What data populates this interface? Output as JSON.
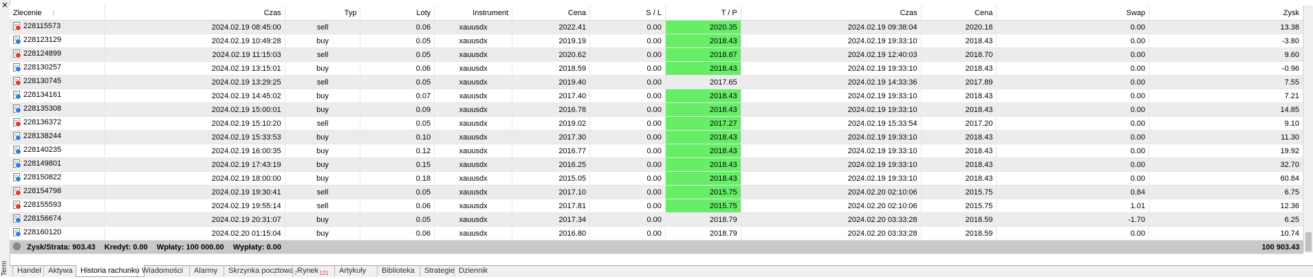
{
  "panel": {
    "close_glyph": "×",
    "side_label": "Terminal"
  },
  "columns": {
    "ticket": "Zlecenie",
    "sort_glyph": "/",
    "open_time": "Czas",
    "type": "Typ",
    "lots": "Loty",
    "symbol": "Instrument",
    "open_price": "Cena",
    "sl": "S / L",
    "tp": "T / P",
    "close_time": "Czas",
    "close_price": "Cena",
    "swap": "Swap",
    "profit": "Zysk"
  },
  "colors": {
    "tp_highlight": "#66ee66",
    "sell_icon": "#e03b2b",
    "buy_icon": "#2f7fd8"
  },
  "icons": {
    "sell": "sell-ticket-icon",
    "buy": "buy-ticket-icon",
    "summary": "summary-dot-icon"
  },
  "rows": [
    {
      "ticket": "228115573",
      "open_time": "2024.02.19 08:45:00",
      "type": "sell",
      "lots": "0.06",
      "symbol": "xauusdx",
      "open_price": "2022.41",
      "sl": "0.00",
      "tp": "2020.35",
      "tp_hit": true,
      "close_time": "2024.02.19 09:38:04",
      "close_price": "2020.18",
      "swap": "0.00",
      "profit": "13.38"
    },
    {
      "ticket": "228123129",
      "open_time": "2024.02.19 10:49:28",
      "type": "buy",
      "lots": "0.05",
      "symbol": "xauusdx",
      "open_price": "2019.19",
      "sl": "0.00",
      "tp": "2018.43",
      "tp_hit": true,
      "close_time": "2024.02.19 19:33:10",
      "close_price": "2018.43",
      "swap": "0.00",
      "profit": "-3.80"
    },
    {
      "ticket": "228124899",
      "open_time": "2024.02.19 11:15:03",
      "type": "sell",
      "lots": "0.05",
      "symbol": "xauusdx",
      "open_price": "2020.62",
      "sl": "0.00",
      "tp": "2018.87",
      "tp_hit": true,
      "close_time": "2024.02.19 12:40:03",
      "close_price": "2018.70",
      "swap": "0.00",
      "profit": "9.60"
    },
    {
      "ticket": "228130257",
      "open_time": "2024.02.19 13:15:01",
      "type": "buy",
      "lots": "0.06",
      "symbol": "xauusdx",
      "open_price": "2018.59",
      "sl": "0.00",
      "tp": "2018.43",
      "tp_hit": true,
      "close_time": "2024.02.19 19:33:10",
      "close_price": "2018.43",
      "swap": "0.00",
      "profit": "-0.96"
    },
    {
      "ticket": "228130745",
      "open_time": "2024.02.19 13:29:25",
      "type": "sell",
      "lots": "0.05",
      "symbol": "xauusdx",
      "open_price": "2019.40",
      "sl": "0.00",
      "tp": "2017.65",
      "tp_hit": false,
      "close_time": "2024.02.19 14:33:36",
      "close_price": "2017.89",
      "swap": "0.00",
      "profit": "7.55"
    },
    {
      "ticket": "228134161",
      "open_time": "2024.02.19 14:45:02",
      "type": "buy",
      "lots": "0.07",
      "symbol": "xauusdx",
      "open_price": "2017.40",
      "sl": "0.00",
      "tp": "2018.43",
      "tp_hit": true,
      "close_time": "2024.02.19 19:33:10",
      "close_price": "2018.43",
      "swap": "0.00",
      "profit": "7.21"
    },
    {
      "ticket": "228135308",
      "open_time": "2024.02.19 15:00:01",
      "type": "buy",
      "lots": "0.09",
      "symbol": "xauusdx",
      "open_price": "2016.78",
      "sl": "0.00",
      "tp": "2018.43",
      "tp_hit": true,
      "close_time": "2024.02.19 19:33:10",
      "close_price": "2018.43",
      "swap": "0.00",
      "profit": "14.85"
    },
    {
      "ticket": "228136372",
      "open_time": "2024.02.19 15:10:20",
      "type": "sell",
      "lots": "0.05",
      "symbol": "xauusdx",
      "open_price": "2019.02",
      "sl": "0.00",
      "tp": "2017.27",
      "tp_hit": true,
      "close_time": "2024.02.19 15:33:54",
      "close_price": "2017.20",
      "swap": "0.00",
      "profit": "9.10"
    },
    {
      "ticket": "228138244",
      "open_time": "2024.02.19 15:33:53",
      "type": "buy",
      "lots": "0.10",
      "symbol": "xauusdx",
      "open_price": "2017.30",
      "sl": "0.00",
      "tp": "2018.43",
      "tp_hit": true,
      "close_time": "2024.02.19 19:33:10",
      "close_price": "2018.43",
      "swap": "0.00",
      "profit": "11.30"
    },
    {
      "ticket": "228140235",
      "open_time": "2024.02.19 16:00:35",
      "type": "buy",
      "lots": "0.12",
      "symbol": "xauusdx",
      "open_price": "2016.77",
      "sl": "0.00",
      "tp": "2018.43",
      "tp_hit": true,
      "close_time": "2024.02.19 19:33:10",
      "close_price": "2018.43",
      "swap": "0.00",
      "profit": "19.92"
    },
    {
      "ticket": "228149801",
      "open_time": "2024.02.19 17:43:19",
      "type": "buy",
      "lots": "0.15",
      "symbol": "xauusdx",
      "open_price": "2016.25",
      "sl": "0.00",
      "tp": "2018.43",
      "tp_hit": true,
      "close_time": "2024.02.19 19:33:10",
      "close_price": "2018.43",
      "swap": "0.00",
      "profit": "32.70"
    },
    {
      "ticket": "228150822",
      "open_time": "2024.02.19 18:00:00",
      "type": "buy",
      "lots": "0.18",
      "symbol": "xauusdx",
      "open_price": "2015.05",
      "sl": "0.00",
      "tp": "2018.43",
      "tp_hit": true,
      "close_time": "2024.02.19 19:33:10",
      "close_price": "2018.43",
      "swap": "0.00",
      "profit": "60.84"
    },
    {
      "ticket": "228154798",
      "open_time": "2024.02.19 19:30:41",
      "type": "sell",
      "lots": "0.05",
      "symbol": "xauusdx",
      "open_price": "2017.10",
      "sl": "0.00",
      "tp": "2015.75",
      "tp_hit": true,
      "close_time": "2024.02.20 02:10:06",
      "close_price": "2015.75",
      "swap": "0.84",
      "profit": "6.75"
    },
    {
      "ticket": "228155593",
      "open_time": "2024.02.19 19:55:14",
      "type": "sell",
      "lots": "0.06",
      "symbol": "xauusdx",
      "open_price": "2017.81",
      "sl": "0.00",
      "tp": "2015.75",
      "tp_hit": true,
      "close_time": "2024.02.20 02:10:06",
      "close_price": "2015.75",
      "swap": "1.01",
      "profit": "12.36"
    },
    {
      "ticket": "228156674",
      "open_time": "2024.02.19 20:31:07",
      "type": "buy",
      "lots": "0.05",
      "symbol": "xauusdx",
      "open_price": "2017.34",
      "sl": "0.00",
      "tp": "2018.79",
      "tp_hit": false,
      "close_time": "2024.02.20 03:33:28",
      "close_price": "2018.59",
      "swap": "-1.70",
      "profit": "6.25"
    },
    {
      "ticket": "228160120",
      "open_time": "2024.02.20 01:15:04",
      "type": "buy",
      "lots": "0.06",
      "symbol": "xauusdx",
      "open_price": "2016.80",
      "sl": "0.00",
      "tp": "2018.79",
      "tp_hit": false,
      "close_time": "2024.02.20 03:33:28",
      "close_price": "2018.59",
      "swap": "0.00",
      "profit": "10.74"
    }
  ],
  "summary": {
    "profit_loss": "Zysk/Strata: 903.43",
    "credit": "Kredyt: 0.00",
    "deposits": "Wpłaty: 100 000.00",
    "withdrawals": "Wypłaty: 0.00",
    "balance": "100 903.43"
  },
  "tabs": [
    {
      "label": "Handel",
      "badge": "",
      "active": false
    },
    {
      "label": "Aktywa",
      "badge": "",
      "active": false
    },
    {
      "label": "Historia rachunku",
      "badge": "",
      "active": true
    },
    {
      "label": "Wiadomości",
      "badge": "",
      "active": false
    },
    {
      "label": "Alarmy",
      "badge": "",
      "active": false
    },
    {
      "label": "Skrzynka pocztowa",
      "badge": "7",
      "active": false
    },
    {
      "label": "Rynek",
      "badge": "121",
      "active": false
    },
    {
      "label": "Artykuły",
      "badge": "",
      "active": false
    },
    {
      "label": "Biblioteka",
      "badge": "",
      "active": false
    },
    {
      "label": "Strategie",
      "badge": "",
      "active": false
    },
    {
      "label": "Dziennik",
      "badge": "",
      "active": false
    }
  ]
}
